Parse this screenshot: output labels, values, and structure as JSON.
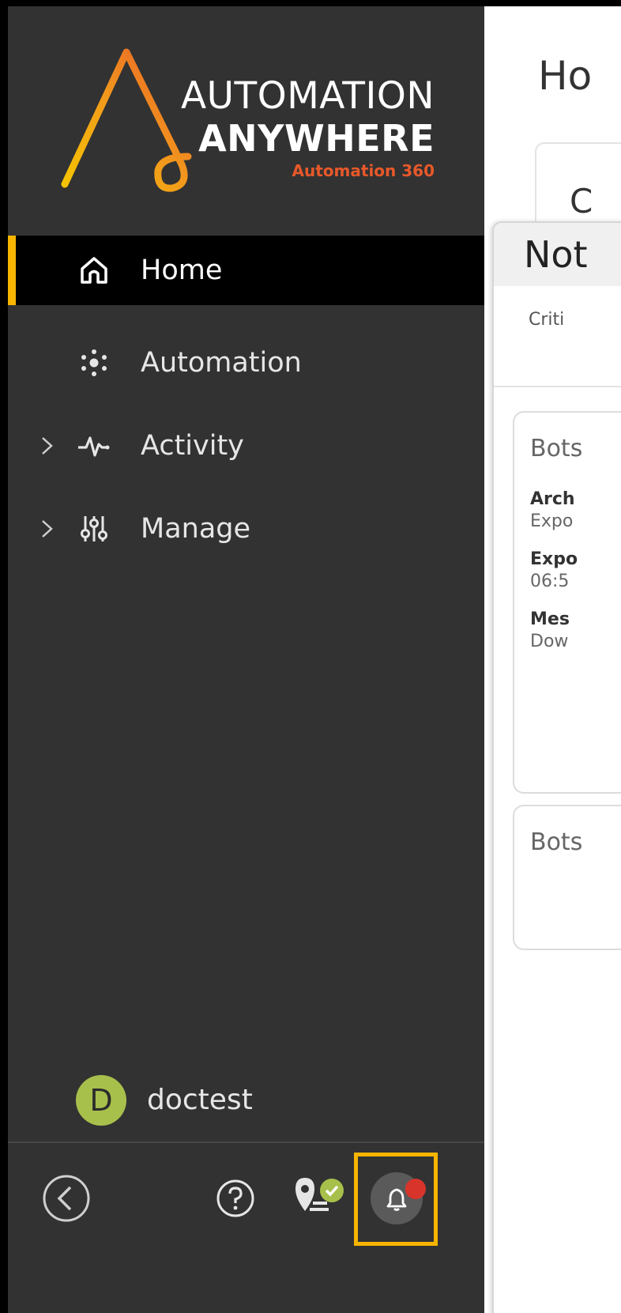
{
  "logo": {
    "line1": "AUTOMATION",
    "line2": "ANYWHERE",
    "line3": "Automation 360"
  },
  "sidebar": {
    "items": [
      {
        "label": "Home",
        "icon": "home-icon",
        "active": true,
        "expandable": false
      },
      {
        "label": "Automation",
        "icon": "automation-icon",
        "active": false,
        "expandable": false
      },
      {
        "label": "Activity",
        "icon": "activity-pulse-icon",
        "active": false,
        "expandable": true
      },
      {
        "label": "Manage",
        "icon": "manage-sliders-icon",
        "active": false,
        "expandable": true
      }
    ],
    "user": {
      "initial": "D",
      "name": "doctest"
    },
    "bottom": {
      "collapse_icon": "collapse-chevron-icon",
      "help_icon": "help-icon",
      "location_icon": "location-check-icon",
      "notification_icon": "bell-icon",
      "notification_unread": true
    }
  },
  "main": {
    "title": "Ho",
    "tab_label": "C"
  },
  "notifications": {
    "title": "Not",
    "filter": "Criti",
    "cards": [
      {
        "title": "Bots",
        "fields": [
          {
            "label": "Arch",
            "value": "Expo"
          },
          {
            "label": "Expo",
            "value": "06:5"
          },
          {
            "label": "Mes",
            "value": "Dow"
          }
        ]
      },
      {
        "title": "Bots"
      }
    ]
  },
  "colors": {
    "sidebar_bg": "#323232",
    "active_bg": "#000000",
    "accent": "#f7b500",
    "brand_orange": "#e8582a",
    "avatar_bg": "#a7c04c",
    "notification_dot": "#d9342b"
  }
}
